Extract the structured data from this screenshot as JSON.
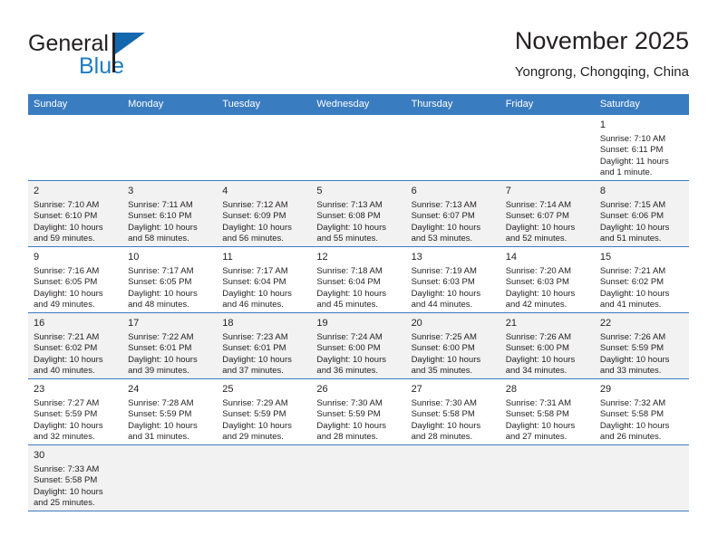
{
  "brand": {
    "line1": "General",
    "line2": "Blue",
    "logo_icon": "triangle-logo-icon",
    "accent_color": "#1368ad"
  },
  "header": {
    "title": "November 2025",
    "subtitle": "Yongrong, Chongqing, China"
  },
  "theme": {
    "header_bg": "#3a7cc0",
    "header_text": "#ffffff",
    "row_shade": "#f2f2f2",
    "text": "#231f20"
  },
  "weekday_headers": [
    "Sunday",
    "Monday",
    "Tuesday",
    "Wednesday",
    "Thursday",
    "Friday",
    "Saturday"
  ],
  "weeks": [
    [
      {
        "day": "",
        "sunrise": "",
        "sunset": "",
        "daylight1": "",
        "daylight2": ""
      },
      {
        "day": "",
        "sunrise": "",
        "sunset": "",
        "daylight1": "",
        "daylight2": ""
      },
      {
        "day": "",
        "sunrise": "",
        "sunset": "",
        "daylight1": "",
        "daylight2": ""
      },
      {
        "day": "",
        "sunrise": "",
        "sunset": "",
        "daylight1": "",
        "daylight2": ""
      },
      {
        "day": "",
        "sunrise": "",
        "sunset": "",
        "daylight1": "",
        "daylight2": ""
      },
      {
        "day": "",
        "sunrise": "",
        "sunset": "",
        "daylight1": "",
        "daylight2": ""
      },
      {
        "day": "1",
        "sunrise": "Sunrise: 7:10 AM",
        "sunset": "Sunset: 6:11 PM",
        "daylight1": "Daylight: 11 hours",
        "daylight2": "and 1 minute."
      }
    ],
    [
      {
        "day": "2",
        "sunrise": "Sunrise: 7:10 AM",
        "sunset": "Sunset: 6:10 PM",
        "daylight1": "Daylight: 10 hours",
        "daylight2": "and 59 minutes."
      },
      {
        "day": "3",
        "sunrise": "Sunrise: 7:11 AM",
        "sunset": "Sunset: 6:10 PM",
        "daylight1": "Daylight: 10 hours",
        "daylight2": "and 58 minutes."
      },
      {
        "day": "4",
        "sunrise": "Sunrise: 7:12 AM",
        "sunset": "Sunset: 6:09 PM",
        "daylight1": "Daylight: 10 hours",
        "daylight2": "and 56 minutes."
      },
      {
        "day": "5",
        "sunrise": "Sunrise: 7:13 AM",
        "sunset": "Sunset: 6:08 PM",
        "daylight1": "Daylight: 10 hours",
        "daylight2": "and 55 minutes."
      },
      {
        "day": "6",
        "sunrise": "Sunrise: 7:13 AM",
        "sunset": "Sunset: 6:07 PM",
        "daylight1": "Daylight: 10 hours",
        "daylight2": "and 53 minutes."
      },
      {
        "day": "7",
        "sunrise": "Sunrise: 7:14 AM",
        "sunset": "Sunset: 6:07 PM",
        "daylight1": "Daylight: 10 hours",
        "daylight2": "and 52 minutes."
      },
      {
        "day": "8",
        "sunrise": "Sunrise: 7:15 AM",
        "sunset": "Sunset: 6:06 PM",
        "daylight1": "Daylight: 10 hours",
        "daylight2": "and 51 minutes."
      }
    ],
    [
      {
        "day": "9",
        "sunrise": "Sunrise: 7:16 AM",
        "sunset": "Sunset: 6:05 PM",
        "daylight1": "Daylight: 10 hours",
        "daylight2": "and 49 minutes."
      },
      {
        "day": "10",
        "sunrise": "Sunrise: 7:17 AM",
        "sunset": "Sunset: 6:05 PM",
        "daylight1": "Daylight: 10 hours",
        "daylight2": "and 48 minutes."
      },
      {
        "day": "11",
        "sunrise": "Sunrise: 7:17 AM",
        "sunset": "Sunset: 6:04 PM",
        "daylight1": "Daylight: 10 hours",
        "daylight2": "and 46 minutes."
      },
      {
        "day": "12",
        "sunrise": "Sunrise: 7:18 AM",
        "sunset": "Sunset: 6:04 PM",
        "daylight1": "Daylight: 10 hours",
        "daylight2": "and 45 minutes."
      },
      {
        "day": "13",
        "sunrise": "Sunrise: 7:19 AM",
        "sunset": "Sunset: 6:03 PM",
        "daylight1": "Daylight: 10 hours",
        "daylight2": "and 44 minutes."
      },
      {
        "day": "14",
        "sunrise": "Sunrise: 7:20 AM",
        "sunset": "Sunset: 6:03 PM",
        "daylight1": "Daylight: 10 hours",
        "daylight2": "and 42 minutes."
      },
      {
        "day": "15",
        "sunrise": "Sunrise: 7:21 AM",
        "sunset": "Sunset: 6:02 PM",
        "daylight1": "Daylight: 10 hours",
        "daylight2": "and 41 minutes."
      }
    ],
    [
      {
        "day": "16",
        "sunrise": "Sunrise: 7:21 AM",
        "sunset": "Sunset: 6:02 PM",
        "daylight1": "Daylight: 10 hours",
        "daylight2": "and 40 minutes."
      },
      {
        "day": "17",
        "sunrise": "Sunrise: 7:22 AM",
        "sunset": "Sunset: 6:01 PM",
        "daylight1": "Daylight: 10 hours",
        "daylight2": "and 39 minutes."
      },
      {
        "day": "18",
        "sunrise": "Sunrise: 7:23 AM",
        "sunset": "Sunset: 6:01 PM",
        "daylight1": "Daylight: 10 hours",
        "daylight2": "and 37 minutes."
      },
      {
        "day": "19",
        "sunrise": "Sunrise: 7:24 AM",
        "sunset": "Sunset: 6:00 PM",
        "daylight1": "Daylight: 10 hours",
        "daylight2": "and 36 minutes."
      },
      {
        "day": "20",
        "sunrise": "Sunrise: 7:25 AM",
        "sunset": "Sunset: 6:00 PM",
        "daylight1": "Daylight: 10 hours",
        "daylight2": "and 35 minutes."
      },
      {
        "day": "21",
        "sunrise": "Sunrise: 7:26 AM",
        "sunset": "Sunset: 6:00 PM",
        "daylight1": "Daylight: 10 hours",
        "daylight2": "and 34 minutes."
      },
      {
        "day": "22",
        "sunrise": "Sunrise: 7:26 AM",
        "sunset": "Sunset: 5:59 PM",
        "daylight1": "Daylight: 10 hours",
        "daylight2": "and 33 minutes."
      }
    ],
    [
      {
        "day": "23",
        "sunrise": "Sunrise: 7:27 AM",
        "sunset": "Sunset: 5:59 PM",
        "daylight1": "Daylight: 10 hours",
        "daylight2": "and 32 minutes."
      },
      {
        "day": "24",
        "sunrise": "Sunrise: 7:28 AM",
        "sunset": "Sunset: 5:59 PM",
        "daylight1": "Daylight: 10 hours",
        "daylight2": "and 31 minutes."
      },
      {
        "day": "25",
        "sunrise": "Sunrise: 7:29 AM",
        "sunset": "Sunset: 5:59 PM",
        "daylight1": "Daylight: 10 hours",
        "daylight2": "and 29 minutes."
      },
      {
        "day": "26",
        "sunrise": "Sunrise: 7:30 AM",
        "sunset": "Sunset: 5:59 PM",
        "daylight1": "Daylight: 10 hours",
        "daylight2": "and 28 minutes."
      },
      {
        "day": "27",
        "sunrise": "Sunrise: 7:30 AM",
        "sunset": "Sunset: 5:58 PM",
        "daylight1": "Daylight: 10 hours",
        "daylight2": "and 28 minutes."
      },
      {
        "day": "28",
        "sunrise": "Sunrise: 7:31 AM",
        "sunset": "Sunset: 5:58 PM",
        "daylight1": "Daylight: 10 hours",
        "daylight2": "and 27 minutes."
      },
      {
        "day": "29",
        "sunrise": "Sunrise: 7:32 AM",
        "sunset": "Sunset: 5:58 PM",
        "daylight1": "Daylight: 10 hours",
        "daylight2": "and 26 minutes."
      }
    ],
    [
      {
        "day": "30",
        "sunrise": "Sunrise: 7:33 AM",
        "sunset": "Sunset: 5:58 PM",
        "daylight1": "Daylight: 10 hours",
        "daylight2": "and 25 minutes."
      },
      {
        "day": "",
        "sunrise": "",
        "sunset": "",
        "daylight1": "",
        "daylight2": ""
      },
      {
        "day": "",
        "sunrise": "",
        "sunset": "",
        "daylight1": "",
        "daylight2": ""
      },
      {
        "day": "",
        "sunrise": "",
        "sunset": "",
        "daylight1": "",
        "daylight2": ""
      },
      {
        "day": "",
        "sunrise": "",
        "sunset": "",
        "daylight1": "",
        "daylight2": ""
      },
      {
        "day": "",
        "sunrise": "",
        "sunset": "",
        "daylight1": "",
        "daylight2": ""
      },
      {
        "day": "",
        "sunrise": "",
        "sunset": "",
        "daylight1": "",
        "daylight2": ""
      }
    ]
  ]
}
